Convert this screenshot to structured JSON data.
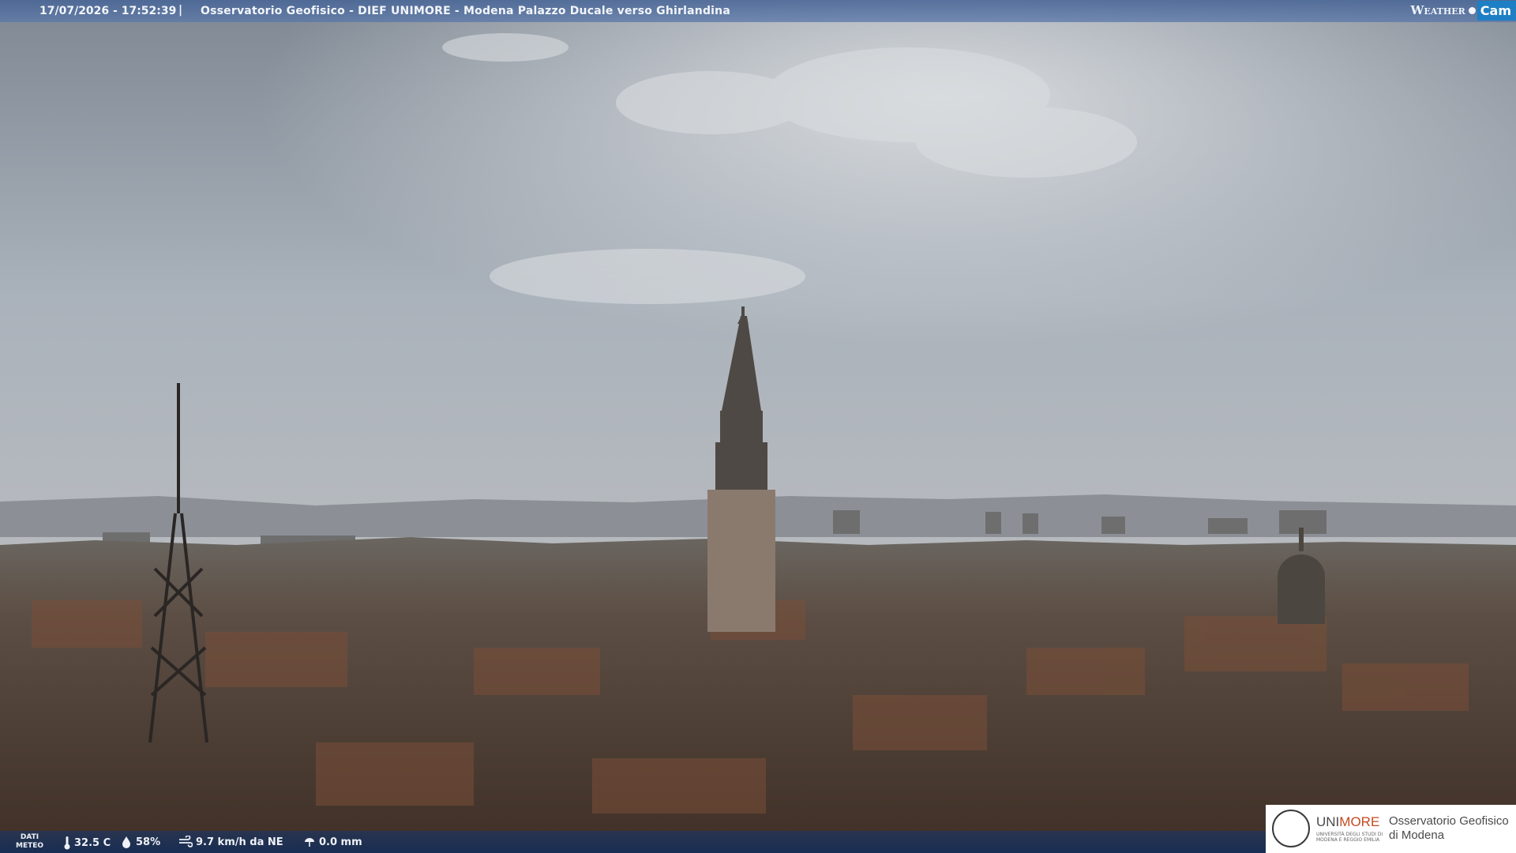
{
  "overlay": {
    "timestamp": "17/07/2026 - 17:52:39",
    "separator": "|",
    "title": "Osservatorio Geofisico - DIEF UNIMORE - Modena Palazzo Ducale verso Ghirlandina",
    "brand_weather": "Weather",
    "brand_cam": "Cam"
  },
  "weather": {
    "label_line1": "DATI",
    "label_line2": "METEO",
    "temperature": "32.5 C",
    "humidity": "58%",
    "wind": "9.7 km/h da NE",
    "rain": "0.0 mm",
    "icons": [
      "thermometer-icon",
      "humidity-drop-icon",
      "wind-icon",
      "rain-gauge-icon"
    ]
  },
  "logo": {
    "uni_prefix": "UNI",
    "uni_suffix": "MORE",
    "uni_subtitle": "UNIVERSITÀ DEGLI STUDI DI MODENA E REGGIO EMILIA",
    "observatory_line1": "Osservatorio Geofisico",
    "observatory_line2": "di Modena"
  },
  "colors": {
    "overlay_bar": "#4a6a9e",
    "brand_blue": "#1e7fc4",
    "unimore_orange": "#c44a1e"
  }
}
